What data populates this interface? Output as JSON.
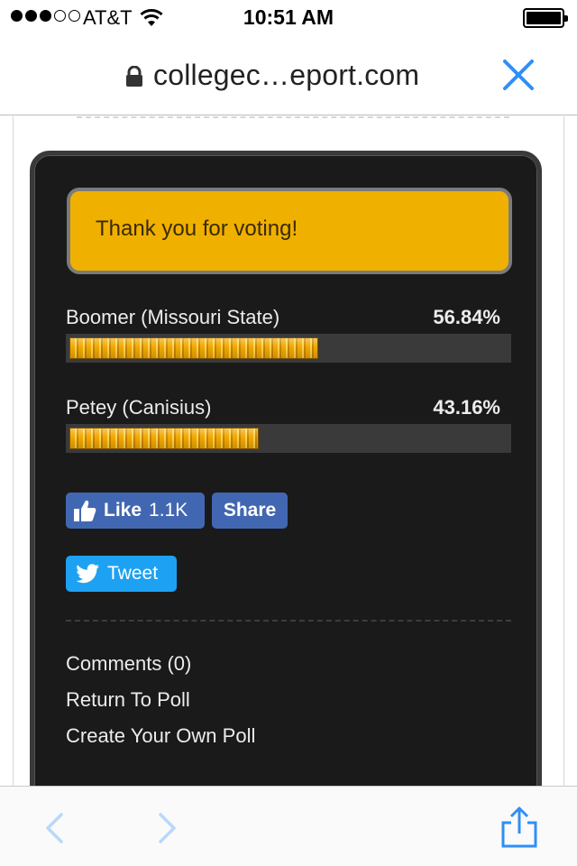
{
  "status_bar": {
    "signal_bars_filled": 3,
    "signal_bars_total": 5,
    "carrier": "AT&T",
    "time": "10:51 AM",
    "battery_level": 1.0
  },
  "address_bar": {
    "url": "collegec…eport.com",
    "close_icon": "close-icon",
    "lock_icon": "lock-icon"
  },
  "poll": {
    "thanks_message": "Thank you for voting!",
    "results": [
      {
        "label": "Boomer (Missouri State)",
        "percent_text": "56.84%",
        "percent": 56.84
      },
      {
        "label": "Petey (Canisius)",
        "percent_text": "43.16%",
        "percent": 43.16
      }
    ],
    "social": {
      "like_label": "Like",
      "like_count": "1.1K",
      "share_label": "Share",
      "tweet_label": "Tweet"
    },
    "links": {
      "comments": "Comments (0)",
      "return": "Return To Poll",
      "create": "Create Your Own Poll"
    }
  },
  "colors": {
    "accent": "#f0b000",
    "card_bg": "#1a1a1a",
    "facebook": "#4267b2",
    "twitter": "#1da1f2",
    "ios_blue": "#2f8ff5"
  },
  "toolbar": {
    "back_icon": "chevron-left-icon",
    "forward_icon": "chevron-right-icon",
    "share_icon": "share-icon"
  }
}
